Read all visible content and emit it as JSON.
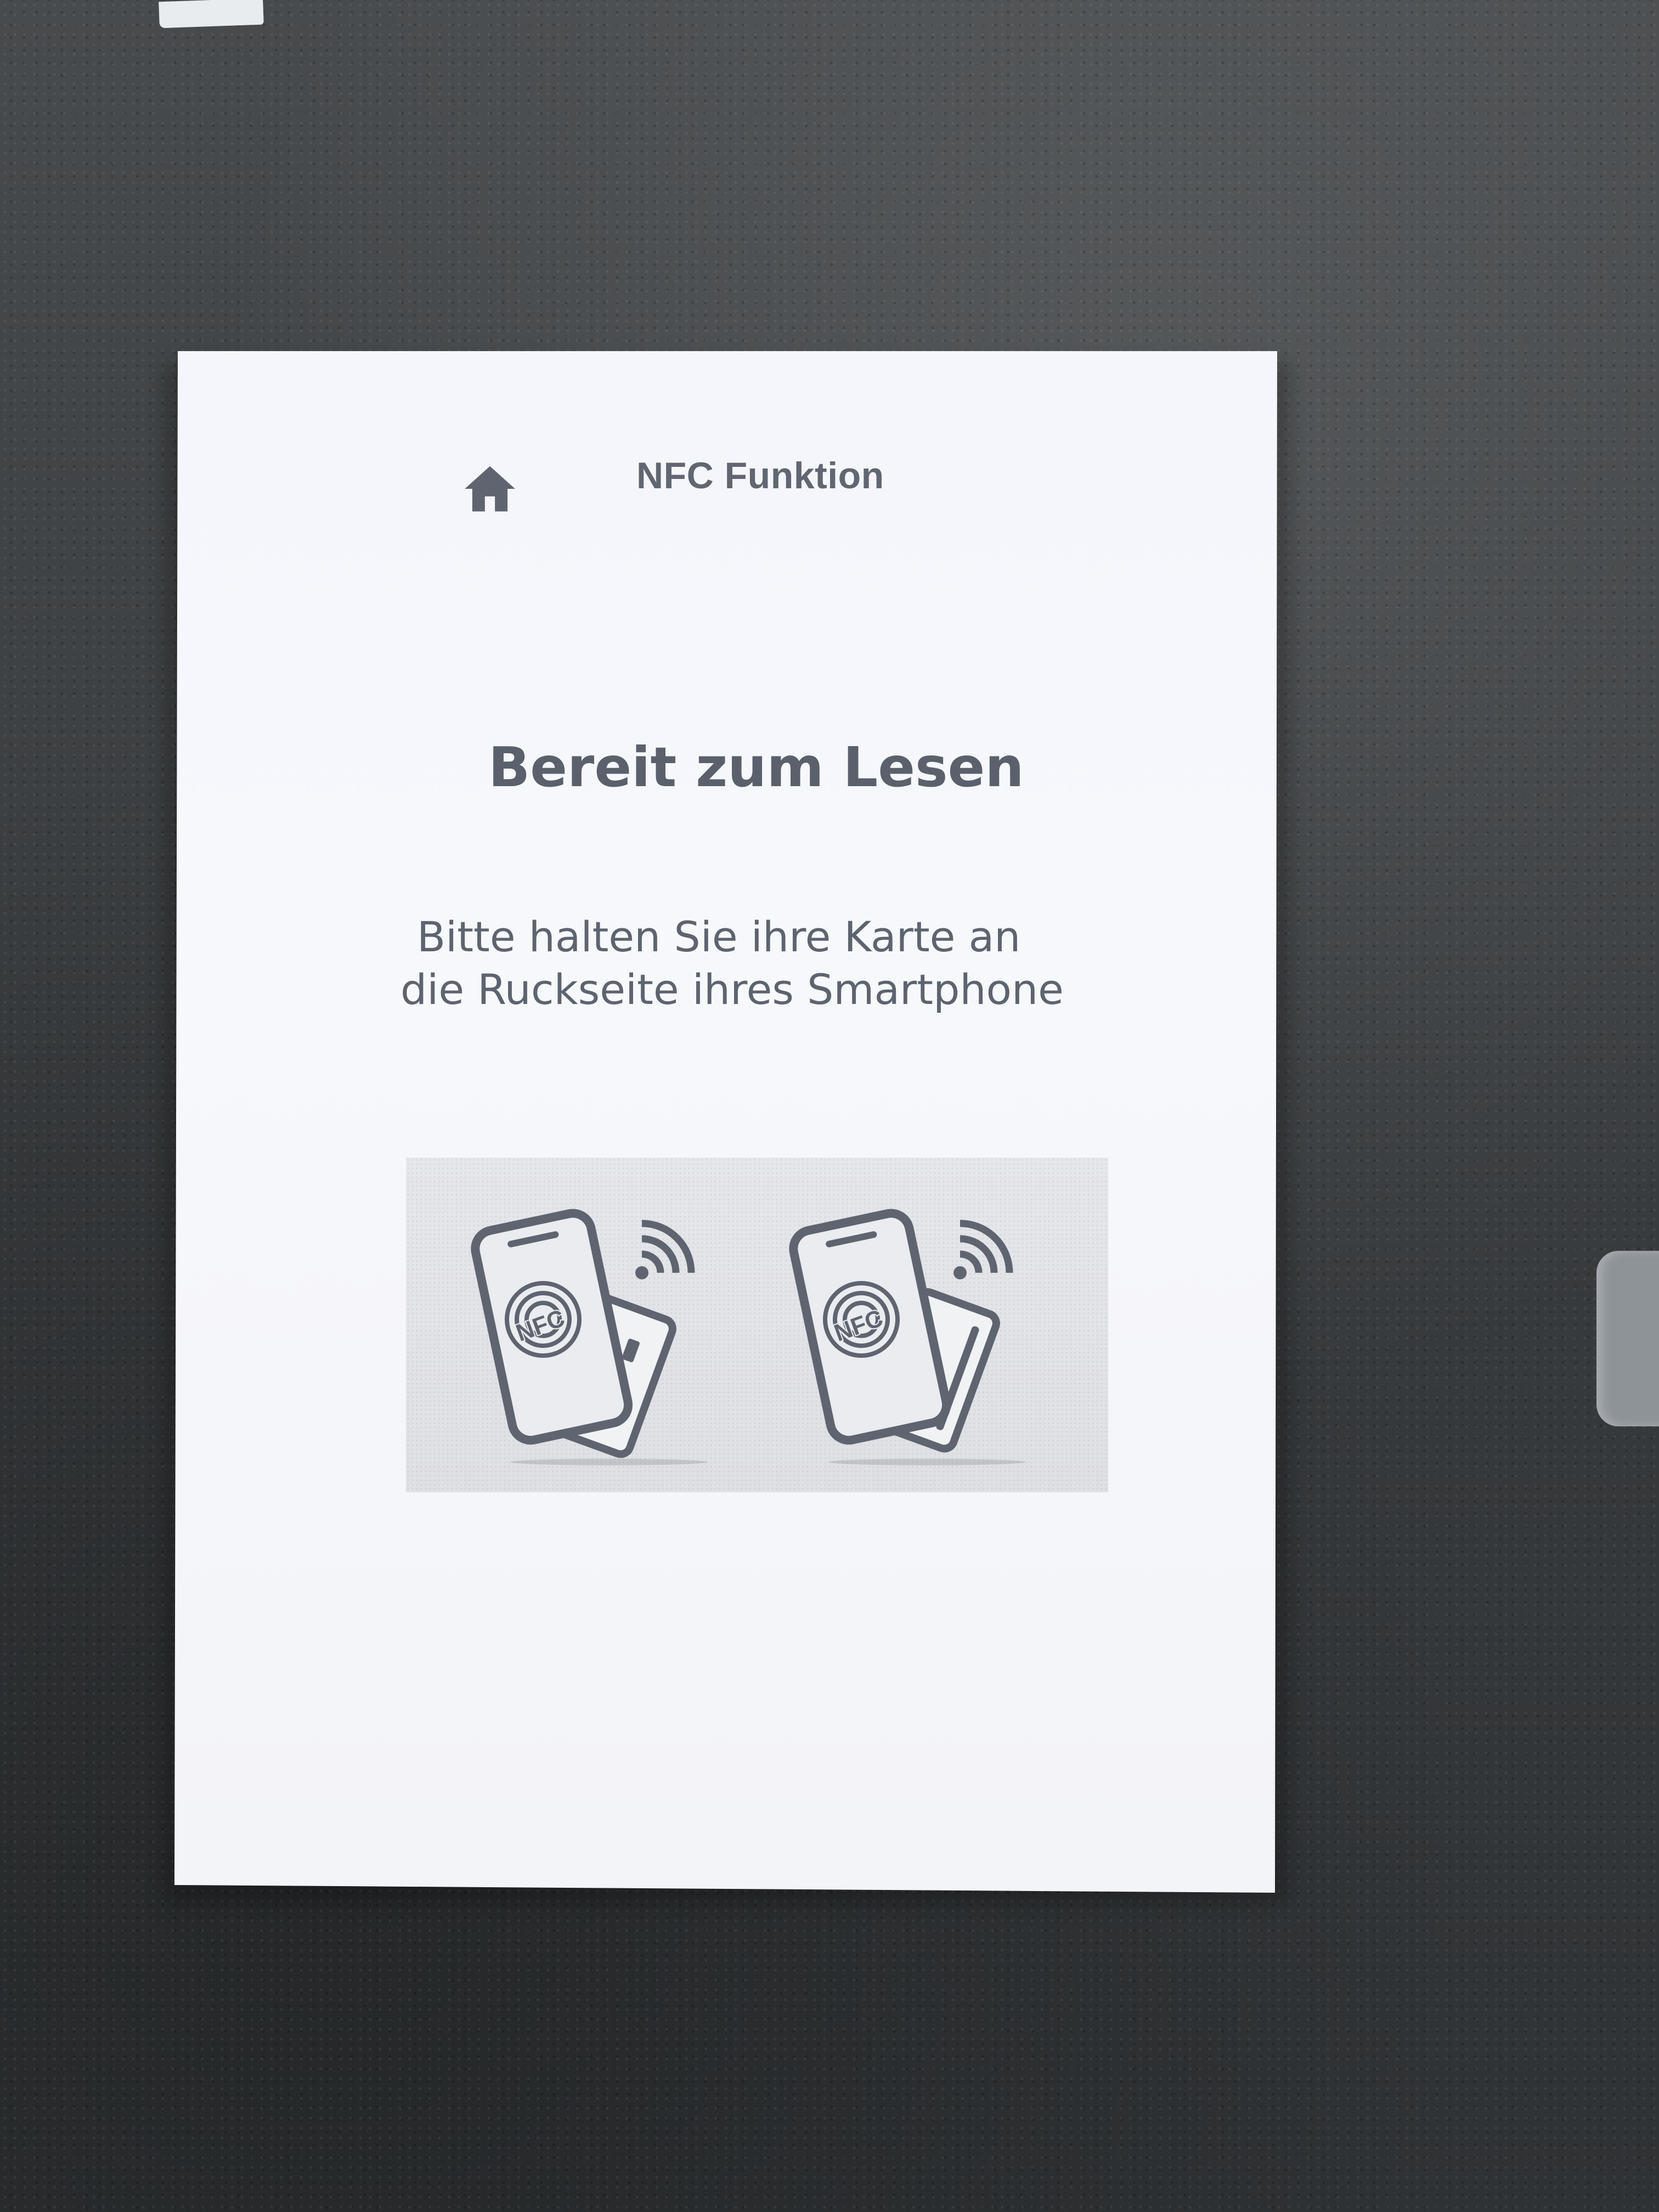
{
  "header": {
    "home_icon": "home-icon",
    "title": "NFC Funktion"
  },
  "main": {
    "title": "Bereit zum Lesen",
    "instruction_line1": "Bitte halten Sie ihre Karte an",
    "instruction_line2": "die Ruckseite ihres Smartphone"
  },
  "illustration": {
    "left": {
      "phone_label": "NFC",
      "icons": [
        "smartphone-icon",
        "nfc-icon",
        "card-icon",
        "wireless-signal-icon"
      ]
    },
    "right": {
      "phone_label": "NFC",
      "icons": [
        "smartphone-icon",
        "nfc-icon",
        "card-icon",
        "wireless-signal-icon"
      ]
    }
  },
  "colors": {
    "ink": "#616672",
    "paper": "#f5f6fa",
    "surface": "#3b3e40",
    "illustration_bg": "#e3e4e8"
  }
}
